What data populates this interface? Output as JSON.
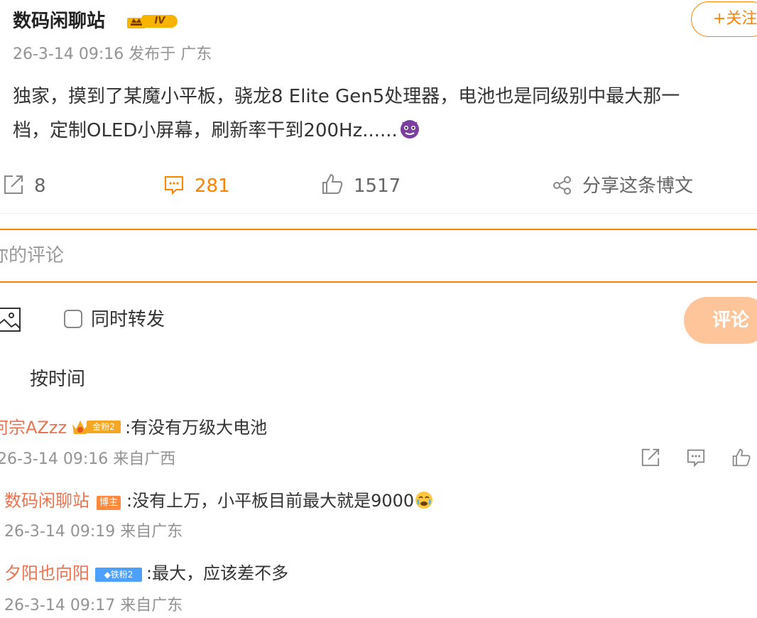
{
  "post": {
    "author": "数码闲聊站",
    "vip_level": "IV",
    "follow_label": "+关注",
    "meta": "26-3-14 09:16 发布于 广东",
    "text_line1": "独家，摸到了某魔小平板，骁龙8 Elite Gen5处理器，电池也是同级别中最大那一",
    "text_line2": "档，定制OLED小屏幕，刷新率干到200Hz......"
  },
  "actions": {
    "repost_count": "8",
    "comment_count": "281",
    "like_count": "1517",
    "share_label": "分享这条博文"
  },
  "composer": {
    "placeholder": "你的评论",
    "repost_label": "同时转发",
    "submit_label": "评论"
  },
  "sort": {
    "label": "按时间"
  },
  "comments": [
    {
      "user": "何宗AZzz",
      "badge": "金粉2",
      "text": ":有没有万级大电池",
      "meta": "26-3-14 09:16 来自广西"
    }
  ],
  "replies": [
    {
      "user": "数码闲聊站",
      "badge": "博主",
      "text": ":没有上万，小平板目前最大就是9000",
      "meta": "26-3-14 09:19 来自广东"
    },
    {
      "user": "夕阳也向阳",
      "badge": "◆铁粉2",
      "text": ":最大，应该差不多",
      "meta": "26-3-14 09:17 来自广东"
    }
  ],
  "colors": {
    "accent": "#ff8200",
    "username": "#eb7350",
    "meta": "#939393",
    "submit_disabled": "#ffc59a"
  },
  "icons": [
    "vip-crown-icon",
    "devil-emoji-icon",
    "repost-icon",
    "comment-icon",
    "like-icon",
    "share-icon",
    "image-icon",
    "checkbox-icon",
    "crown-fan-icon",
    "crying-emoji-icon"
  ]
}
